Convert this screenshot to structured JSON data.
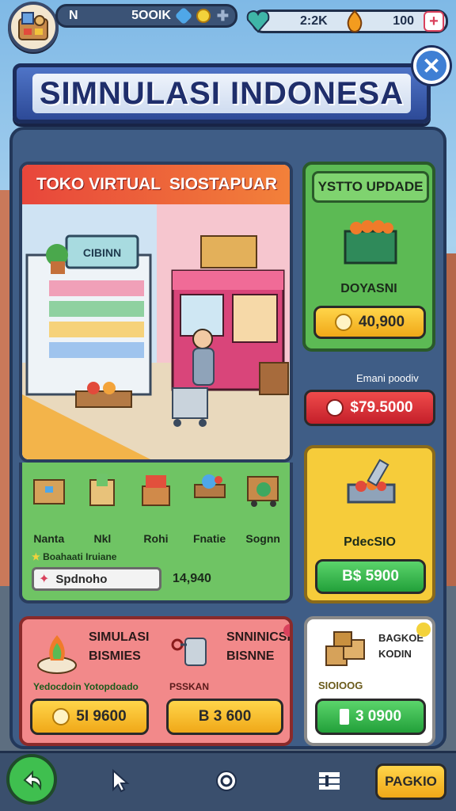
{
  "topbar": {
    "player_stat": "N",
    "coins": "5OOIK",
    "gems": "2:2K",
    "energy": "100"
  },
  "banner": {
    "title": "SIMNULASI INDONESA"
  },
  "store": {
    "tab_left": "TOKO VIRTUAL",
    "tab_right": "SIOSTAPUAR",
    "shop_sign": "CIBINN",
    "items": [
      {
        "label": "Nanta",
        "icon": "box-icon"
      },
      {
        "label": "Nkl",
        "icon": "bag-icon"
      },
      {
        "label": "Rohi",
        "icon": "crate-icon"
      },
      {
        "label": "Fnatie",
        "icon": "stall-icon"
      },
      {
        "label": "Sognn",
        "icon": "cart-icon"
      }
    ],
    "sub_note": "Boahaati Iruiane",
    "search_value": "Spdnoho",
    "search_total": "14,940"
  },
  "upgrade": {
    "title": "YSTTO UPDADE",
    "item_label": "DOYASNI",
    "price": "40,900"
  },
  "special": {
    "caption": "Emani poodiv",
    "price": "$79.5000"
  },
  "yellow_card": {
    "label": "PdecSIO",
    "price": "B$ 5900"
  },
  "sim1": {
    "title_line1": "SIMULASI",
    "title_line2": "BISMIES",
    "note": "Yedocdoin Yotopdoado",
    "price": "5I 9600"
  },
  "sim2": {
    "title_line1": "SNNINICSI",
    "title_line2": "BISNNE",
    "note": "PSSKAN",
    "price": "B 3 600"
  },
  "package": {
    "title_line1": "BAGKOE",
    "title_line2": "KODIN",
    "note": "SIOIOOG",
    "price": "3 0900"
  },
  "bottom_nav": {
    "action_label": "PAGKIO"
  }
}
